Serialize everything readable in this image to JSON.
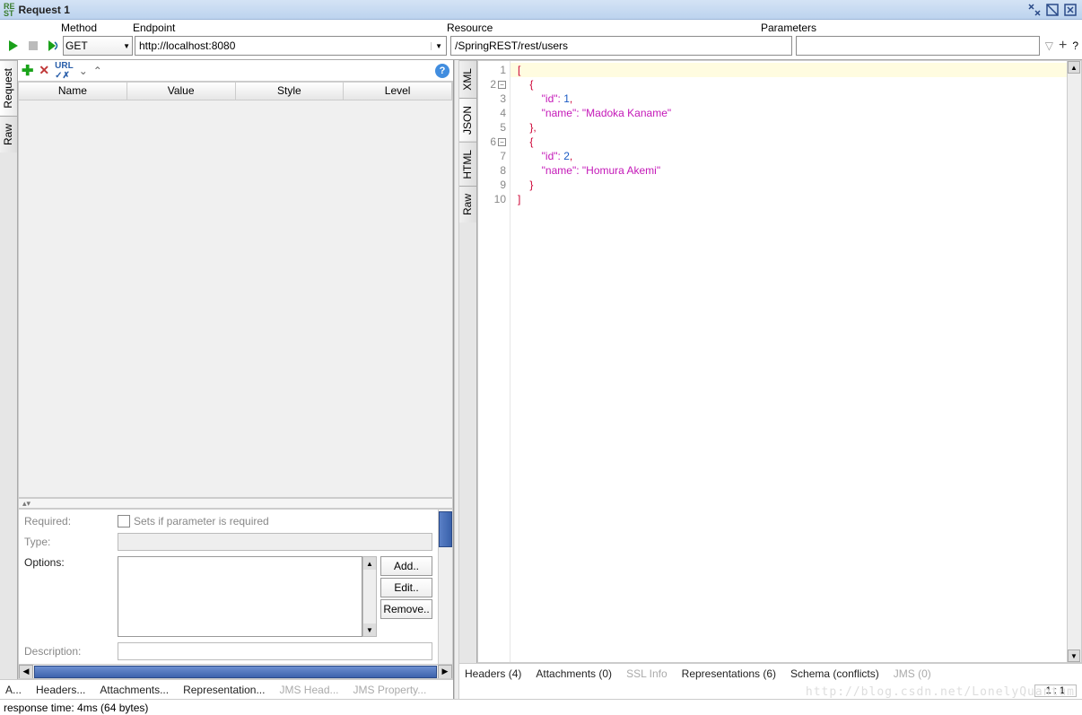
{
  "title": "Request 1",
  "header": {
    "method_label": "Method",
    "endpoint_label": "Endpoint",
    "resource_label": "Resource",
    "parameters_label": "Parameters",
    "method": "GET",
    "endpoint": "http://localhost:8080",
    "resource": "/SpringREST/rest/users",
    "parameters": ""
  },
  "left_tabs": {
    "request": "Request",
    "raw": "Raw"
  },
  "table": {
    "name": "Name",
    "value": "Value",
    "style": "Style",
    "level": "Level"
  },
  "props": {
    "required": "Required:",
    "required_hint": "Sets if parameter is required",
    "type": "Type:",
    "options": "Options:",
    "description": "Description:",
    "add": "Add..",
    "edit": "Edit..",
    "remove": "Remove.."
  },
  "left_bottom": {
    "a": "A...",
    "headers": "Headers...",
    "attachments": "Attachments...",
    "representation": "Representation...",
    "jms_head": "JMS Head...",
    "jms_property": "JMS Property..."
  },
  "right_tabs": {
    "xml": "XML",
    "json": "JSON",
    "html": "HTML",
    "raw": "Raw"
  },
  "json_response": {
    "l1": "[",
    "l2": "    {",
    "l3a": "        \"id\": ",
    "l3b": "1",
    "l3c": ",",
    "l4a": "        \"name\": ",
    "l4b": "\"Madoka Kaname\"",
    "l5": "    },",
    "l6": "    {",
    "l7a": "        \"id\": ",
    "l7b": "2",
    "l7c": ",",
    "l8a": "        \"name\": ",
    "l8b": "\"Homura Akemi\"",
    "l9": "    }",
    "l10": "]"
  },
  "right_bottom": {
    "headers": "Headers (4)",
    "attachments": "Attachments (0)",
    "ssl": "SSL Info",
    "representations": "Representations (6)",
    "schema": "Schema (conflicts)",
    "jms": "JMS (0)"
  },
  "cursor_pos": "1 : 1",
  "status": "response time: 4ms (64 bytes)",
  "watermark": "http://blog.csdn.net/LonelyQuantum"
}
